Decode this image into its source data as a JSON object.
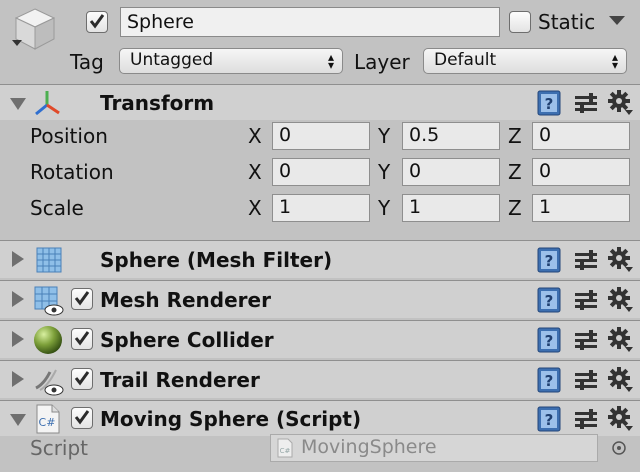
{
  "header": {
    "object_name": "Sphere",
    "static_label": "Static",
    "tag_label": "Tag",
    "tag_value": "Untagged",
    "layer_label": "Layer",
    "layer_value": "Default"
  },
  "transform": {
    "title": "Transform",
    "rows": [
      {
        "label": "Position",
        "x": "0",
        "y": "0.5",
        "z": "0"
      },
      {
        "label": "Rotation",
        "x": "0",
        "y": "0",
        "z": "0"
      },
      {
        "label": "Scale",
        "x": "1",
        "y": "1",
        "z": "1"
      }
    ],
    "axis_x": "X",
    "axis_y": "Y",
    "axis_z": "Z"
  },
  "components": [
    {
      "title": "Sphere (Mesh Filter)",
      "icon": "mesh-filter-icon"
    },
    {
      "title": "Mesh Renderer",
      "icon": "mesh-renderer-icon"
    },
    {
      "title": "Sphere Collider",
      "icon": "sphere-collider-icon"
    },
    {
      "title": "Trail Renderer",
      "icon": "trail-renderer-icon"
    },
    {
      "title": "Moving Sphere (Script)",
      "icon": "csharp-script-icon"
    }
  ],
  "script_row": {
    "label": "Script",
    "value": "MovingSphere"
  },
  "colors": {
    "panel": "#c2c2c2",
    "component_bar": "#d0d0d0",
    "help_blue": "#3d6fb0"
  }
}
